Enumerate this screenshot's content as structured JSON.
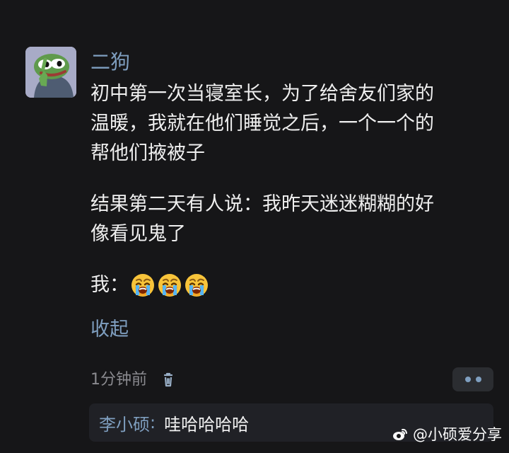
{
  "comment": {
    "author": "二狗",
    "lines": [
      "初中第一次当寝室长，为了给舍友们家的",
      "温暖，我就在他们睡觉之后，一个一个的",
      "帮他们掖被子",
      "结果第二天有人说：我昨天迷迷糊糊的好",
      "像看见鬼了",
      "我："
    ],
    "emoji_name": "crying-face",
    "collapse_label": "收起",
    "time": "1分钟前"
  },
  "reply": {
    "author": "李小硕",
    "separator": ":",
    "text": "哇哈哈哈哈"
  },
  "watermark": {
    "text": "@小硕爱分享"
  },
  "icons": {
    "avatar": "pepe-frog-avatar",
    "delete": "trash-icon",
    "more": "more-icon",
    "watermark": "weibo-icon"
  },
  "colors": {
    "background": "#161618",
    "text": "#efefef",
    "accent": "#7f9fc0",
    "muted": "#8a8a8f",
    "reply_background": "#202126"
  }
}
